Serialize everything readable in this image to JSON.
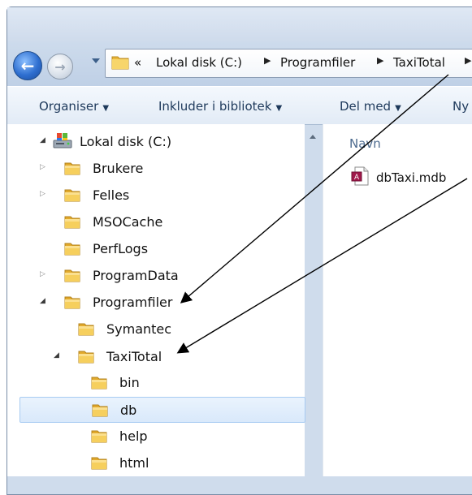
{
  "address": {
    "chevrons": "«",
    "crumbs": [
      "Lokal disk (C:)",
      "Programfiler",
      "TaxiTotal"
    ]
  },
  "toolbar": {
    "organise": "Organiser",
    "include": "Inkluder i bibliotek",
    "share": "Del med",
    "new": "Ny"
  },
  "tree": {
    "root": "Lokal disk (C:)",
    "items": [
      "Brukere",
      "Felles",
      "MSOCache",
      "PerfLogs",
      "ProgramData",
      "Programfiler",
      "Symantec",
      "TaxiTotal",
      "bin",
      "db",
      "help",
      "html"
    ]
  },
  "content": {
    "column_name": "Navn",
    "file": "dbTaxi.mdb"
  },
  "colors": {
    "folder": "#f2c94c",
    "arrow": "#000000",
    "selection": "#d9e9fb"
  },
  "icons": {
    "back": "back-arrow-icon",
    "forward": "forward-arrow-icon",
    "folder": "folder-icon",
    "drive": "drive-icon",
    "file": "access-database-icon"
  }
}
